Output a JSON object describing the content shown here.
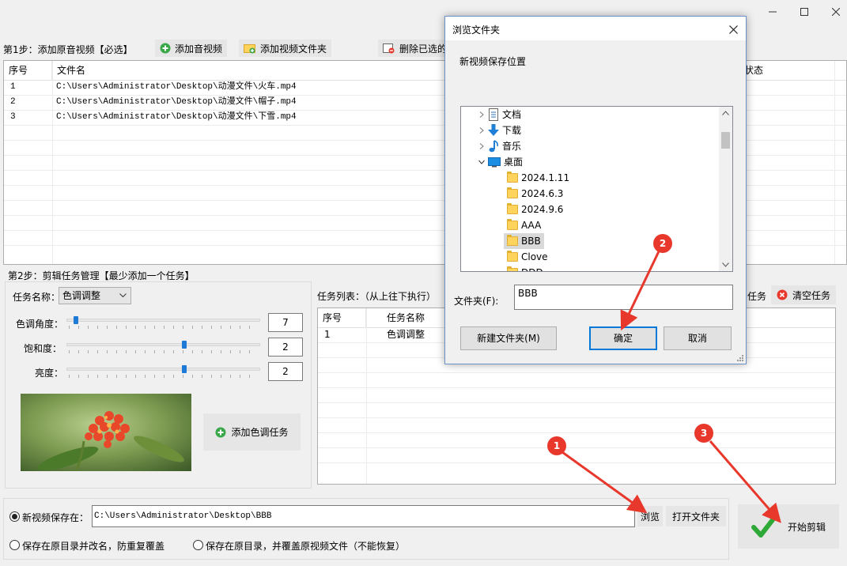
{
  "step1": {
    "label": "第1步：添加原音视频【必选】",
    "add_audio_video": "添加音视频",
    "add_video_folder": "添加视频文件夹",
    "delete_selected": "删除已选的"
  },
  "file_table": {
    "col_index": "序号",
    "col_name": "文件名",
    "col_status": "状态",
    "rows": [
      {
        "index": "1",
        "name": "C:\\Users\\Administrator\\Desktop\\动漫文件\\火车.mp4"
      },
      {
        "index": "2",
        "name": "C:\\Users\\Administrator\\Desktop\\动漫文件\\帽子.mp4"
      },
      {
        "index": "3",
        "name": "C:\\Users\\Administrator\\Desktop\\动漫文件\\下雪.mp4"
      }
    ]
  },
  "step2": {
    "label": "第2步：剪辑任务管理【最少添加一个任务】",
    "task_name_label": "任务名称：",
    "task_name_value": "色调调整",
    "hue_label": "色调角度：",
    "hue_value": "7",
    "hue_level": 0.03,
    "saturation_label": "饱和度：",
    "saturation_value": "2",
    "saturation_level": 0.6,
    "brightness_label": "亮度：",
    "brightness_value": "2",
    "brightness_level": 0.6,
    "add_color_task": "添加色调任务",
    "task_list_label": "任务列表：（从上往下执行）",
    "task_btn_partial": "任务",
    "clear_tasks": "清空任务",
    "task_col_index": "序号",
    "task_col_name": "任务名称",
    "task_rows": [
      {
        "index": "1",
        "name": "色调调整"
      }
    ]
  },
  "output": {
    "save_to_label": "新视频保存在：",
    "save_path": "C:\\Users\\Administrator\\Desktop\\BBB",
    "browse": "浏览",
    "open_folder": "打开文件夹",
    "opt_rename": "保存在原目录并改名，防重复覆盖",
    "opt_overwrite": "保存在原目录，并覆盖原视频文件（不能恢复）",
    "start": "开始剪辑"
  },
  "dialog": {
    "title": "浏览文件夹",
    "description": "新视频保存位置",
    "tree": [
      {
        "label": "文档",
        "icon": "document-icon",
        "expander": "collapsed"
      },
      {
        "label": "下载",
        "icon": "download-icon",
        "expander": "collapsed"
      },
      {
        "label": "音乐",
        "icon": "music-icon",
        "expander": "collapsed"
      },
      {
        "label": "桌面",
        "icon": "desktop-icon",
        "expander": "expanded"
      },
      {
        "label": "2024.1.11",
        "icon": "folder-icon"
      },
      {
        "label": "2024.6.3",
        "icon": "folder-icon"
      },
      {
        "label": "2024.9.6",
        "icon": "folder-icon"
      },
      {
        "label": "AAA",
        "icon": "folder-icon"
      },
      {
        "label": "BBB",
        "icon": "folder-icon",
        "selected": true
      },
      {
        "label": "Clove",
        "icon": "folder-icon"
      },
      {
        "label": "DDD",
        "icon": "folder-icon"
      }
    ],
    "folder_label": "文件夹(F):",
    "folder_value": "BBB",
    "new_folder": "新建文件夹(M)",
    "ok": "确定",
    "cancel": "取消"
  },
  "annotations": {
    "marker_1": "1",
    "marker_2": "2",
    "marker_3": "3",
    "color": "#e8382c"
  }
}
